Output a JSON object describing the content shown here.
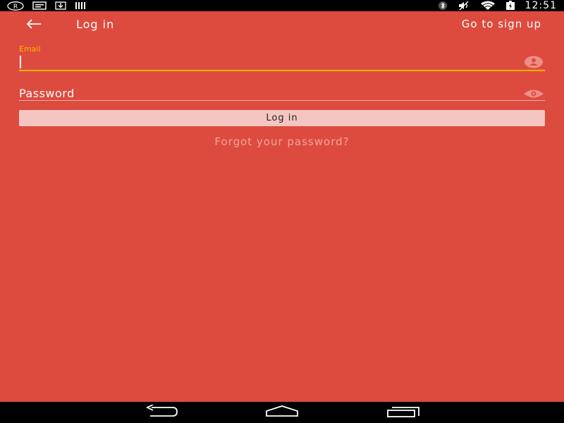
{
  "status_bar": {
    "left_icons": [
      "registered-icon",
      "message-icon",
      "download-icon",
      "barcode-icon"
    ],
    "right_icons": [
      "bluetooth-icon",
      "vibrate-mute-icon",
      "wifi-icon",
      "battery-charging-icon"
    ],
    "time": "12:51"
  },
  "topbar": {
    "back_icon": "arrow-left-icon",
    "title": "Log in",
    "signup_label": "Go to sign up"
  },
  "form": {
    "email_label": "Email",
    "email_value": "",
    "email_icon": "person-icon",
    "password_placeholder": "Password",
    "password_value": "",
    "password_icon": "eye-icon",
    "login_button_label": "Log in",
    "forgot_label": "Forgot your password?"
  },
  "nav_bar": {
    "icons": [
      "nav-back-icon",
      "nav-home-icon",
      "nav-recents-icon"
    ]
  },
  "colors": {
    "background": "#dd4b3e",
    "accent": "#ffb300",
    "button": "#f5c6c1",
    "link_muted": "#f2a49c"
  }
}
